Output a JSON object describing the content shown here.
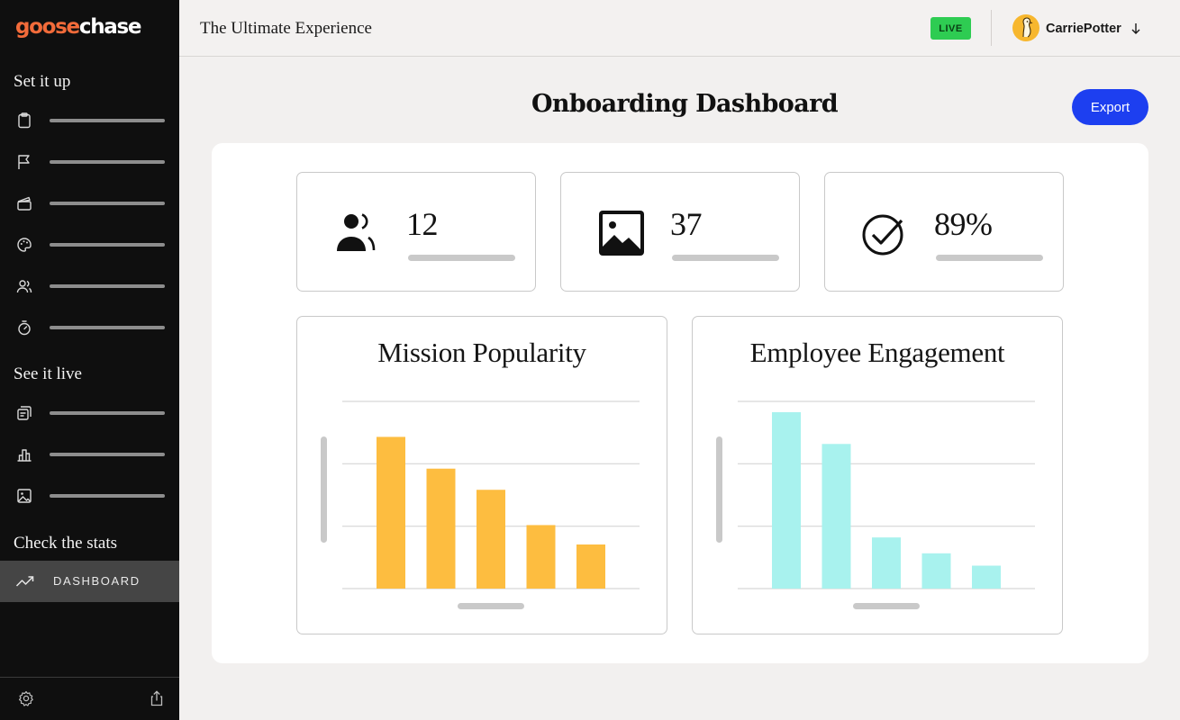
{
  "sidebar": {
    "logo_part1": "goose",
    "logo_part2": "chase",
    "section_setup": "Set it up",
    "section_live": "See it live",
    "section_stats": "Check the stats",
    "active_item_label": "DASHBOARD",
    "setup_icons": [
      "clipboard-icon",
      "flag-icon",
      "clapperboard-icon",
      "palette-icon",
      "users-icon",
      "timer-icon"
    ],
    "live_icons": [
      "activity-feed-icon",
      "leaderboard-icon",
      "gallery-icon"
    ],
    "active_icon": "trending-up-icon",
    "footer_icons": [
      "gear-icon",
      "share-icon"
    ]
  },
  "topbar": {
    "experience_title": "The Ultimate Experience",
    "status_badge": "LIVE",
    "user_name": "CarriePotter"
  },
  "main": {
    "page_title": "Onboarding Dashboard",
    "export_label": "Export",
    "stats": [
      {
        "icon": "participants-icon",
        "value": "12"
      },
      {
        "icon": "image-icon",
        "value": "37"
      },
      {
        "icon": "check-circle-icon",
        "value": "89%"
      }
    ]
  },
  "colors": {
    "accent_blue": "#1d3ff0",
    "live_green": "#2ecc52",
    "logo_orange": "#f26b3a",
    "mission_bar": "#fdbd40",
    "engagement_bar": "#a8f2ee"
  },
  "chart_data": [
    {
      "type": "bar",
      "title": "Mission Popularity",
      "categories": [
        "",
        "",
        "",
        "",
        ""
      ],
      "values": [
        0.86,
        0.68,
        0.56,
        0.36,
        0.25
      ],
      "ylim": [
        0,
        1
      ],
      "grid": true,
      "color": "#fdbd40"
    },
    {
      "type": "bar",
      "title": "Employee Engagement",
      "categories": [
        "",
        "",
        "",
        "",
        ""
      ],
      "values": [
        1.0,
        0.82,
        0.29,
        0.2,
        0.13
      ],
      "ylim": [
        0,
        1
      ],
      "grid": true,
      "color": "#a8f2ee"
    }
  ]
}
